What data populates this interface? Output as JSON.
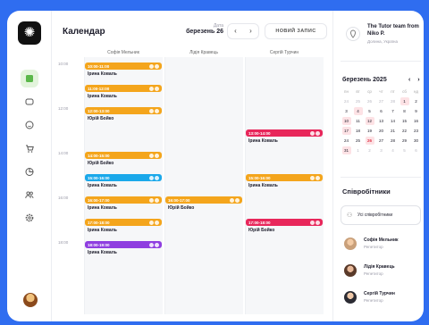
{
  "header": {
    "title": "Календар",
    "date_label": "Дата",
    "date_value": "березень 26",
    "prev": "‹",
    "next": "›",
    "new_button": "НОВИЙ ЗАПИС"
  },
  "columns": [
    "Софія Мельник",
    "Лідія Кравець",
    "Сергій Турчин"
  ],
  "times": [
    "10:00",
    "12:00",
    "14:00",
    "16:00",
    "18:00"
  ],
  "events": [
    {
      "col": 0,
      "time": "10:00-11:00",
      "name": "Ірина Коваль",
      "color": "#f4a51c"
    },
    {
      "col": 0,
      "time": "11:00-12:00",
      "name": "Ірина Коваль",
      "color": "#f4a51c"
    },
    {
      "col": 0,
      "time": "12:00-13:00",
      "name": "Юрій Бойко",
      "color": "#f4a51c"
    },
    {
      "col": 0,
      "time": "14:00-15:00",
      "name": "Юрій Бойко",
      "color": "#f4a51c"
    },
    {
      "col": 0,
      "time": "15:00-16:00",
      "name": "Ірина Коваль",
      "color": "#1aa8ea"
    },
    {
      "col": 0,
      "time": "16:00-17:00",
      "name": "Ірина Коваль",
      "color": "#f4a51c"
    },
    {
      "col": 0,
      "time": "17:00-18:00",
      "name": "Ірина Коваль",
      "color": "#f4a51c"
    },
    {
      "col": 0,
      "time": "18:00-19:00",
      "name": "Ірина Коваль",
      "color": "#8f3ee0"
    },
    {
      "col": 1,
      "time": "16:00-17:00",
      "name": "Юрій Бойко",
      "color": "#f4a51c"
    },
    {
      "col": 2,
      "time": "13:00-14:00",
      "name": "Ірина Коваль",
      "color": "#e8275b"
    },
    {
      "col": 2,
      "time": "15:00-16:00",
      "name": "Ірина Коваль",
      "color": "#f4a51c"
    },
    {
      "col": 2,
      "time": "17:00-18:00",
      "name": "Юрій Бойко",
      "color": "#e8275b"
    }
  ],
  "team": {
    "name": "The Tutor team from Niko P.",
    "location": "Долина, Україна"
  },
  "calendar": {
    "month": "березень 2025",
    "arrows": "‹ ›",
    "weekdays": [
      "пн",
      "вт",
      "ср",
      "чт",
      "пт",
      "сб",
      "нд"
    ],
    "days": [
      [
        "24",
        "muted"
      ],
      [
        "25",
        "muted"
      ],
      [
        "26",
        "muted"
      ],
      [
        "27",
        "muted"
      ],
      [
        "28",
        "muted"
      ],
      [
        "1",
        "hl"
      ],
      [
        "2",
        ""
      ],
      [
        "3",
        ""
      ],
      [
        "4",
        "hl"
      ],
      [
        "5",
        ""
      ],
      [
        "6",
        ""
      ],
      [
        "7",
        ""
      ],
      [
        "8",
        ""
      ],
      [
        "9",
        ""
      ],
      [
        "10",
        "hl"
      ],
      [
        "11",
        ""
      ],
      [
        "12",
        "hl"
      ],
      [
        "13",
        ""
      ],
      [
        "14",
        ""
      ],
      [
        "15",
        ""
      ],
      [
        "16",
        ""
      ],
      [
        "17",
        "hl"
      ],
      [
        "18",
        ""
      ],
      [
        "19",
        ""
      ],
      [
        "20",
        ""
      ],
      [
        "21",
        ""
      ],
      [
        "22",
        ""
      ],
      [
        "23",
        ""
      ],
      [
        "24",
        ""
      ],
      [
        "25",
        ""
      ],
      [
        "26",
        "sel"
      ],
      [
        "27",
        ""
      ],
      [
        "28",
        ""
      ],
      [
        "29",
        ""
      ],
      [
        "30",
        ""
      ],
      [
        "31",
        "hl"
      ],
      [
        "1",
        "muted"
      ],
      [
        "2",
        "muted"
      ],
      [
        "3",
        "muted"
      ],
      [
        "4",
        "muted"
      ],
      [
        "5",
        "muted"
      ],
      [
        "6",
        "muted"
      ]
    ]
  },
  "staff": {
    "title": "Співробітники",
    "all": "Усі співробітники",
    "members": [
      {
        "name": "Софія Мельник",
        "role": "Репетитор"
      },
      {
        "name": "Лідія Кравець",
        "role": "Репетитор"
      },
      {
        "name": "Сергій Турчин",
        "role": "Репетитор"
      }
    ]
  }
}
